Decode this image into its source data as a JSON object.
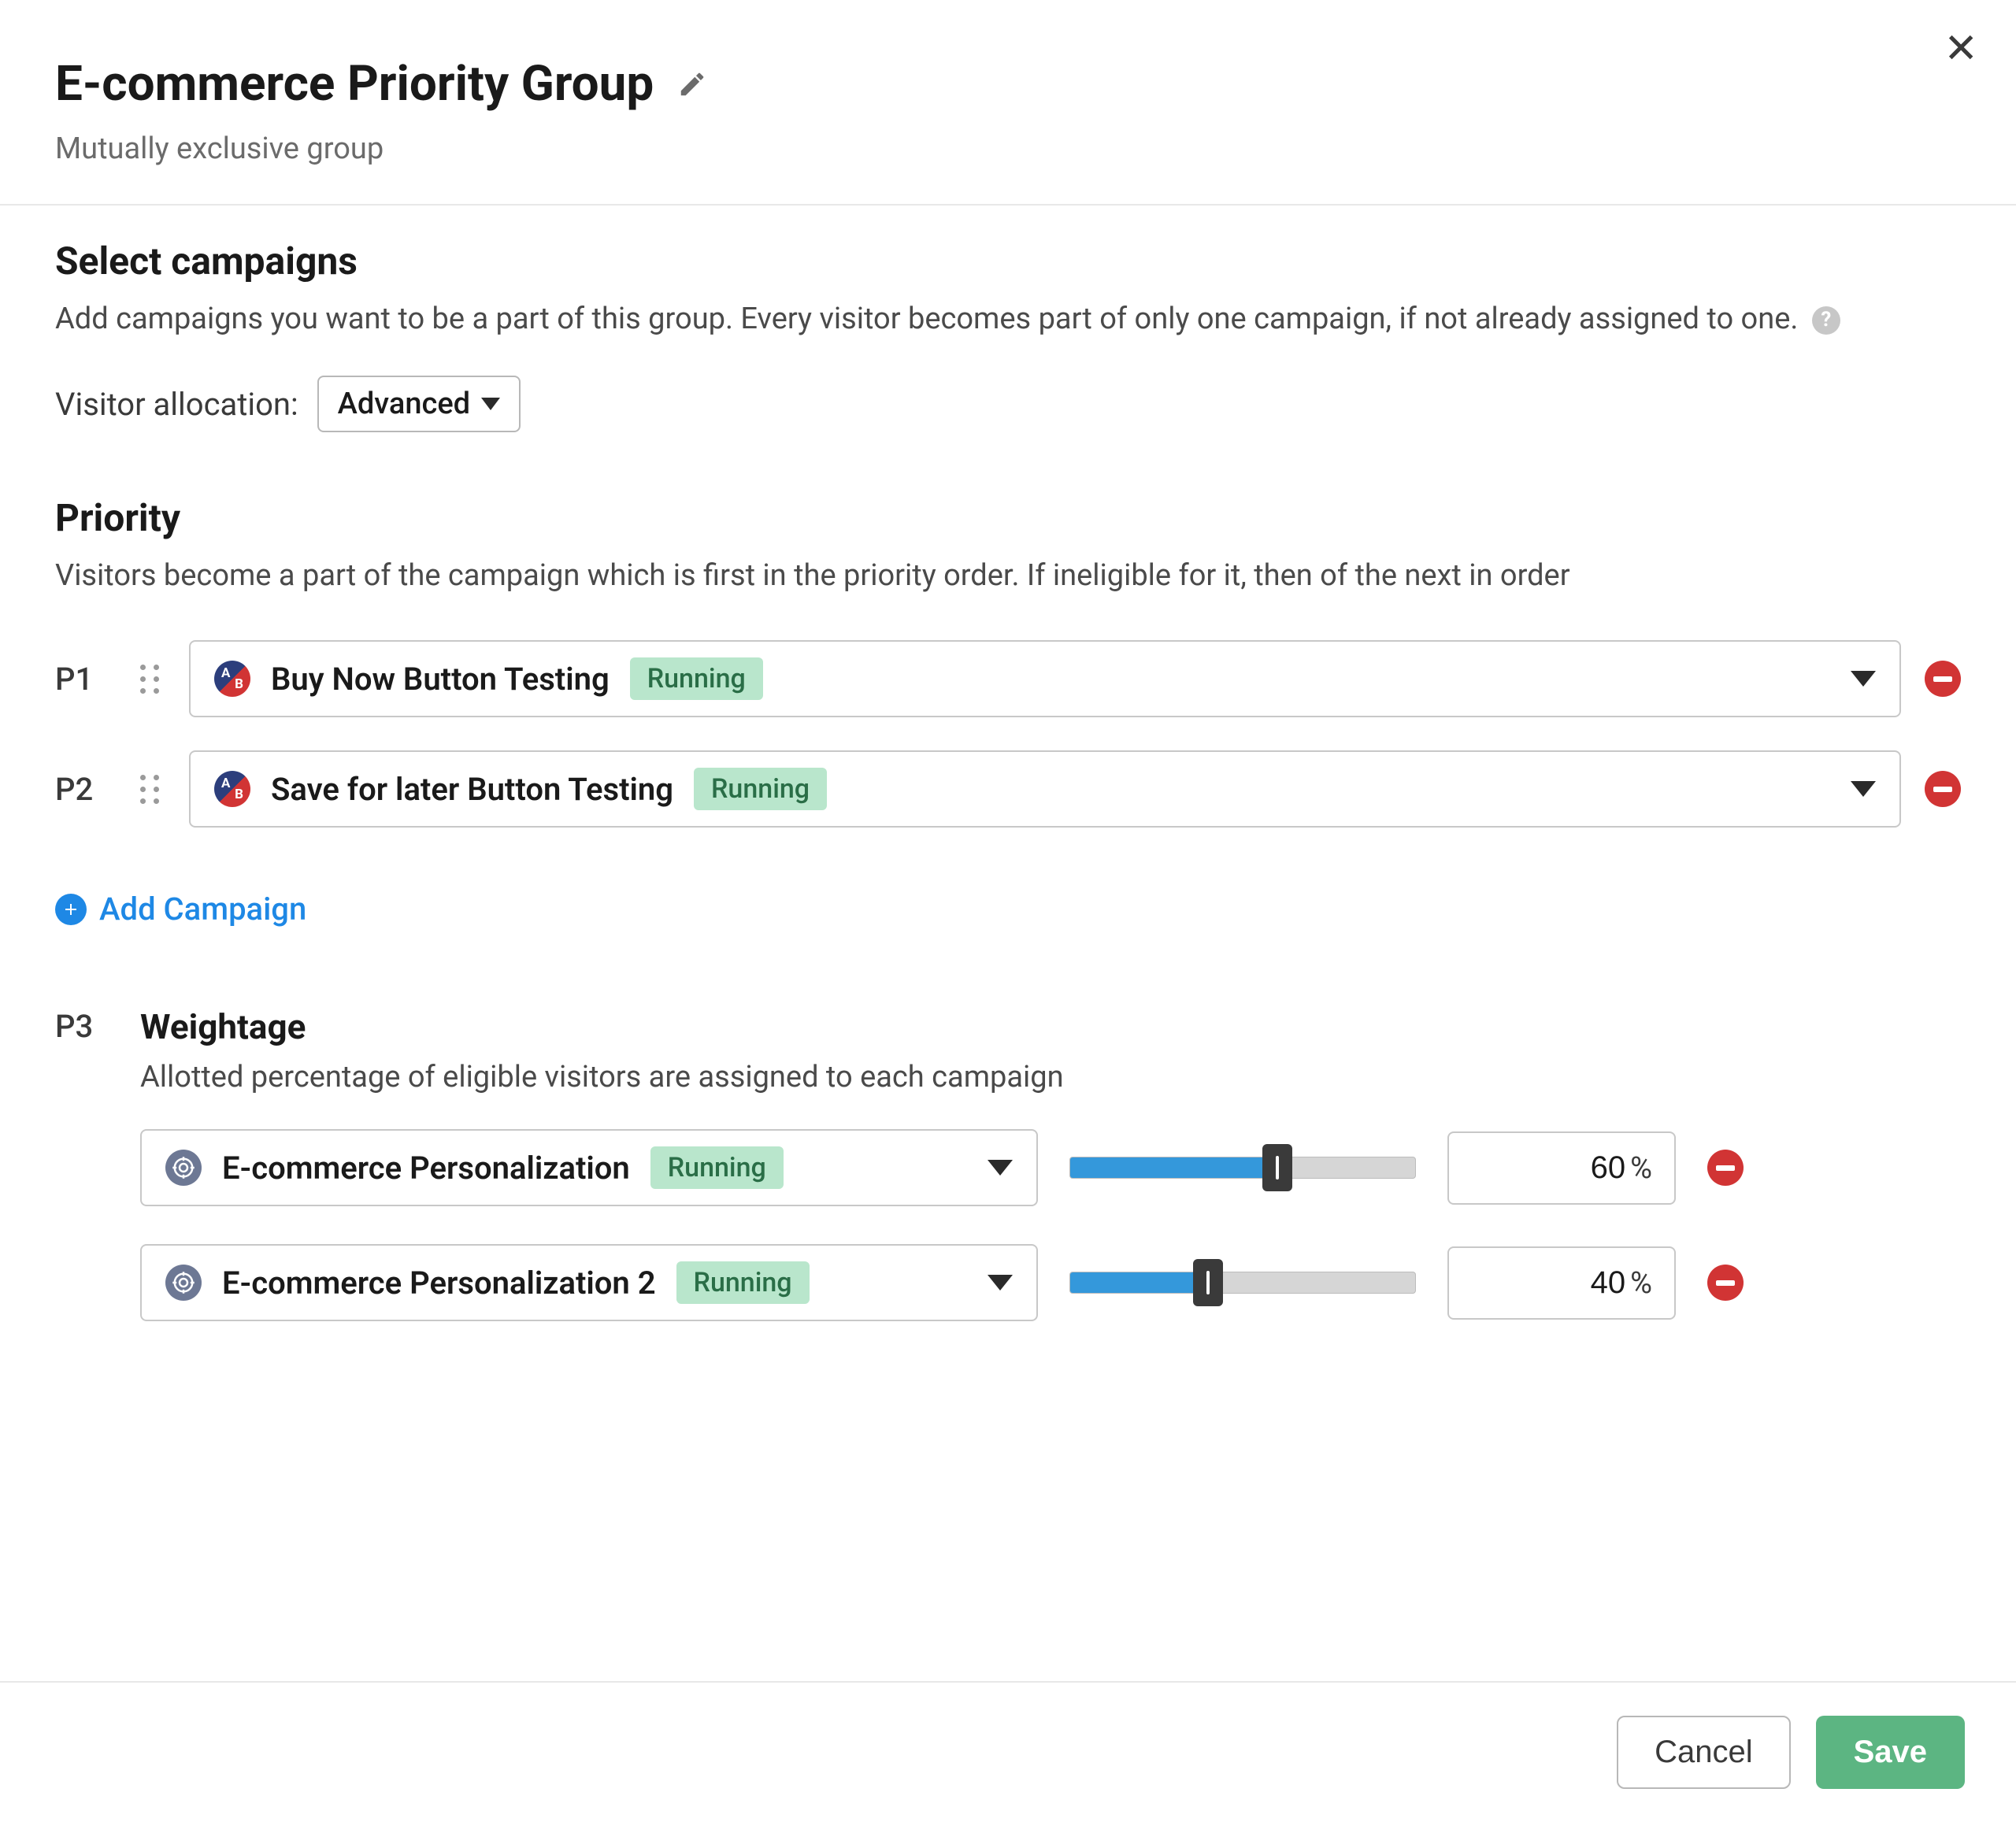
{
  "header": {
    "title": "E-commerce Priority Group",
    "subtitle": "Mutually exclusive group"
  },
  "select_campaigns": {
    "heading": "Select campaigns",
    "description": "Add campaigns you want to be a part of this group. Every visitor becomes part of only one campaign, if not already assigned to one.",
    "allocation_label": "Visitor allocation:",
    "allocation_value": "Advanced"
  },
  "priority": {
    "heading": "Priority",
    "description": "Visitors become a part of the campaign which is first in the priority order. If ineligible for it, then of the next in order",
    "items": [
      {
        "rank": "P1",
        "name": "Buy Now Button Testing",
        "status": "Running"
      },
      {
        "rank": "P2",
        "name": "Save for later Button Testing",
        "status": "Running"
      }
    ],
    "add_label": "Add Campaign"
  },
  "weightage": {
    "rank": "P3",
    "heading": "Weightage",
    "description": "Allotted percentage of eligible visitors are assigned to each campaign",
    "percent_sign": "%",
    "items": [
      {
        "name": "E-commerce Personalization",
        "status": "Running",
        "percent": "60"
      },
      {
        "name": "E-commerce Personalization 2",
        "status": "Running",
        "percent": "40"
      }
    ]
  },
  "footer": {
    "cancel": "Cancel",
    "save": "Save"
  }
}
